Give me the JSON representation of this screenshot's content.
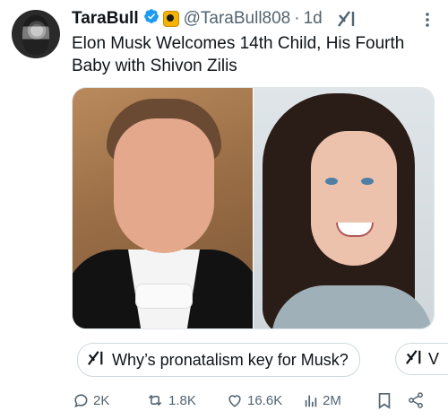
{
  "tweet": {
    "display_name": "TaraBull",
    "handle": "@TaraBull808",
    "dot": "·",
    "time": "1d",
    "text": "Elon Musk Welcomes 14th Child, His Fourth Baby with Shivon Zilis"
  },
  "grok": {
    "question": "Why’s pronatalism key for Musk?",
    "next_partial": "V"
  },
  "actions": {
    "replies": "2K",
    "reposts": "1.8K",
    "likes": "16.6K",
    "views": "2M"
  },
  "colors": {
    "verified_blue": "#1d9bf0",
    "muted_text": "#536471",
    "primary_text": "#0f1419"
  },
  "icons": {
    "verified": "verified-badge-icon",
    "affiliate": "gold-affiliate-badge-icon",
    "grok": "grok-icon",
    "more": "more-icon",
    "reply": "reply-icon",
    "repost": "repost-icon",
    "like": "heart-icon",
    "views": "views-icon",
    "bookmark": "bookmark-icon",
    "share": "share-icon"
  }
}
